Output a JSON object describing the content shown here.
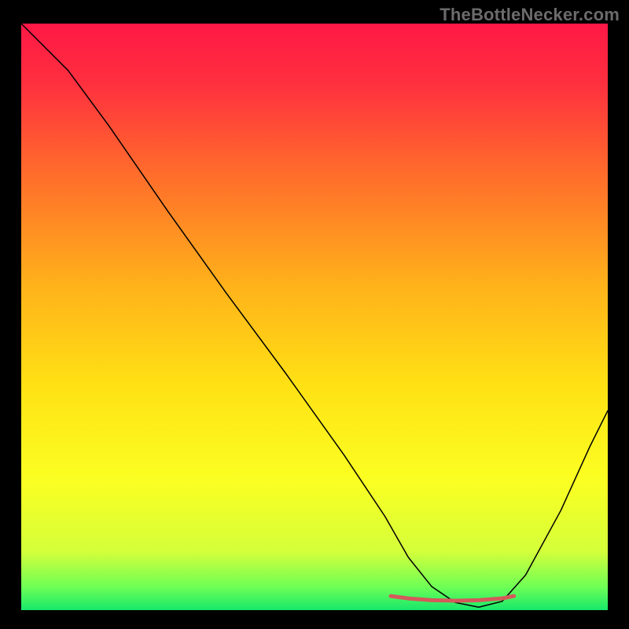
{
  "watermark": "TheBottleNecker.com",
  "chart_data": {
    "type": "line",
    "title": "",
    "xlabel": "",
    "ylabel": "",
    "xlim": [
      0,
      100
    ],
    "ylim": [
      0,
      100
    ],
    "grid": false,
    "legend": false,
    "background_gradient": {
      "stops": [
        {
          "offset": 0.0,
          "color": "#ff1846"
        },
        {
          "offset": 0.1,
          "color": "#ff2f3f"
        },
        {
          "offset": 0.25,
          "color": "#ff6a2c"
        },
        {
          "offset": 0.45,
          "color": "#ffb31a"
        },
        {
          "offset": 0.62,
          "color": "#ffe214"
        },
        {
          "offset": 0.78,
          "color": "#fbff22"
        },
        {
          "offset": 0.9,
          "color": "#d4ff3a"
        },
        {
          "offset": 0.96,
          "color": "#6fff55"
        },
        {
          "offset": 1.0,
          "color": "#17e86b"
        }
      ]
    },
    "series": [
      {
        "name": "bottleneck-curve",
        "color": "#000000",
        "width": 1.5,
        "x": [
          0,
          3,
          8,
          15,
          25,
          35,
          45,
          55,
          62,
          66,
          70,
          74,
          78,
          82,
          86,
          92,
          97,
          100
        ],
        "values": [
          100,
          97,
          92,
          82.5,
          68,
          54,
          40.5,
          26.5,
          16,
          9,
          4,
          1.3,
          0.5,
          1.5,
          6,
          17,
          28,
          34
        ]
      },
      {
        "name": "highlight-band",
        "color": "#d45a5a",
        "width": 5,
        "x": [
          63,
          66,
          70,
          74,
          78,
          82,
          84
        ],
        "values": [
          2.4,
          2.0,
          1.7,
          1.6,
          1.7,
          2.0,
          2.4
        ]
      }
    ]
  }
}
